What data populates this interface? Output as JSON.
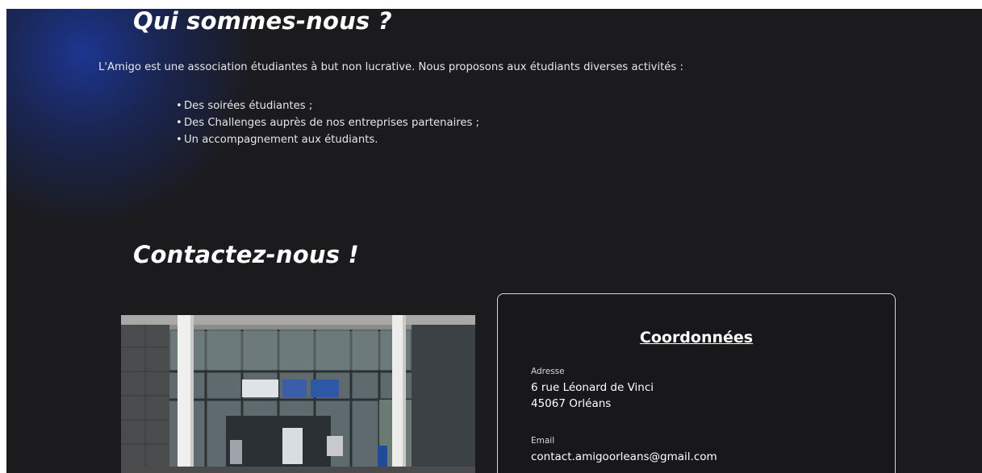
{
  "about": {
    "title": "Qui sommes-nous ?",
    "intro": "L'Amigo est une association étudiantes à but non lucrative. Nous proposons aux étudiants diverses activités :",
    "activities": [
      "Des soirées étudiantes ;",
      "Des Challenges auprès de nos entreprises partenaires ;",
      "Un accompagnement aux étudiants."
    ]
  },
  "contact": {
    "title": "Contactez-nous !",
    "card_title": "Coordonnées",
    "address_label": "Adresse",
    "address_line1": "6 rue Léonard de Vinci",
    "address_line2": "45067 Orléans",
    "email_label": "Email",
    "email": "contact.amigoorleans@gmail.com"
  },
  "colors": {
    "background": "#1b1b1d",
    "glow": "#1c3796",
    "text": "#ffffff"
  }
}
